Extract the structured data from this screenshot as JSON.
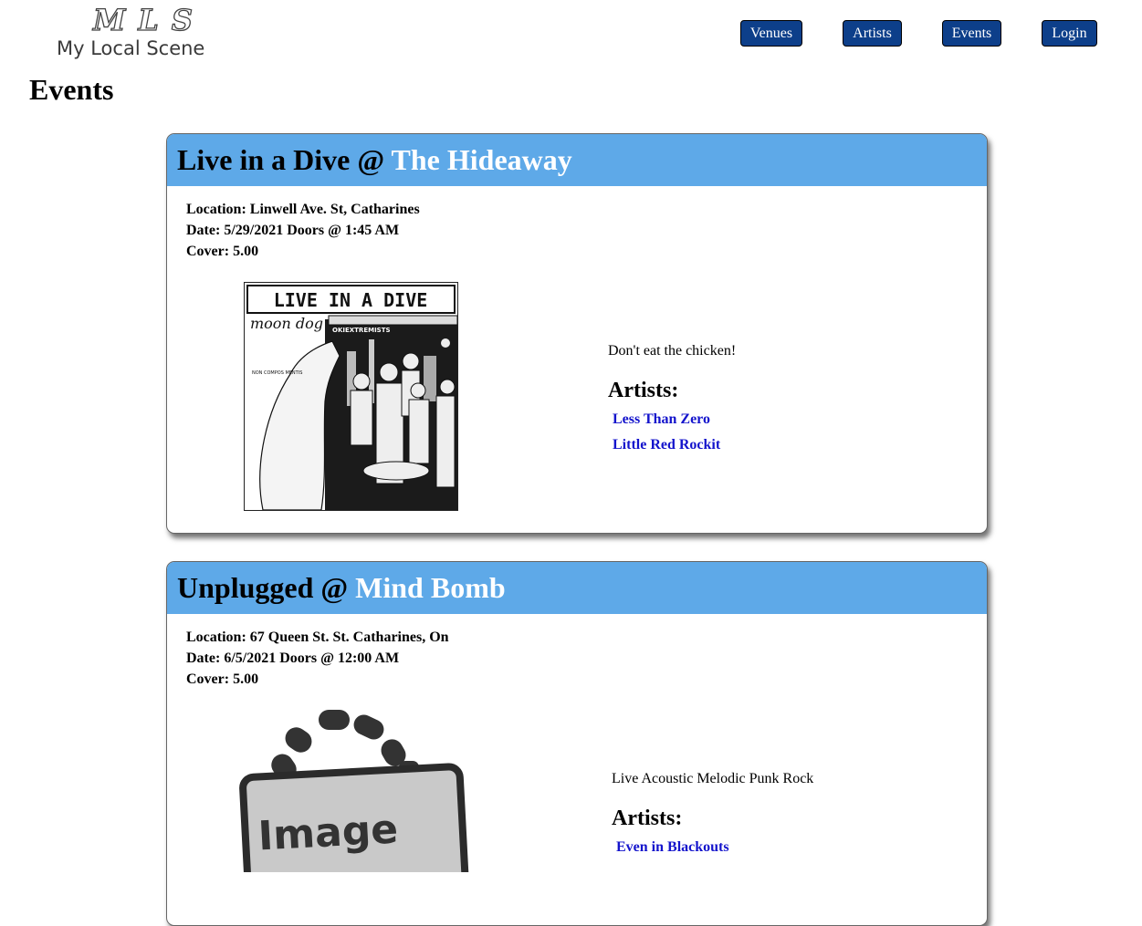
{
  "app": {
    "logo_mark": "MLS",
    "logo_text": "My Local Scene"
  },
  "nav": {
    "items": [
      {
        "label": "Venues"
      },
      {
        "label": "Artists"
      },
      {
        "label": "Events"
      },
      {
        "label": "Login"
      }
    ]
  },
  "page": {
    "title": "Events"
  },
  "colors": {
    "header_blue": "#5ea9e8",
    "nav_button": "#0d3f8a",
    "artist_link": "#1414cc"
  },
  "events": [
    {
      "name": "Live in a Dive",
      "at": "@",
      "venue": "The Hideaway",
      "location": "Location: Linwell Ave. St, Catharines",
      "date": "Date: 5/29/2021 Doors @ 1:45 AM",
      "cover": "Cover: 5.00",
      "poster": {
        "title": "LIVE IN A DIVE",
        "band_a": "moon dog",
        "band_b": "OKIEXTREMISTS",
        "caption": "NON COMPOS MENTIS"
      },
      "description": "Don't eat the chicken!",
      "artists_heading": "Artists:",
      "artists": [
        "Less Than Zero",
        "Little Red Rockit"
      ]
    },
    {
      "name": "Unplugged",
      "at": "@",
      "venue": "Mind Bomb",
      "location": "Location: 67 Queen St. St. Catharines, On",
      "date": "Date: 6/5/2021 Doors @ 12:00 AM",
      "cover": "Cover: 5.00",
      "image_placeholder": "Image",
      "description": "Live Acoustic Melodic Punk Rock",
      "artists_heading": "Artists:",
      "artists": [
        "Even in Blackouts"
      ]
    }
  ]
}
